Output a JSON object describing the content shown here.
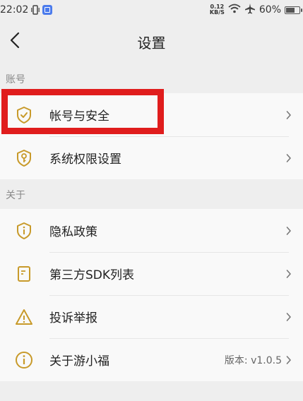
{
  "status_bar": {
    "time": "22:02",
    "net_speed_value": "0.12",
    "net_speed_unit": "KB/S",
    "battery": "60%"
  },
  "header": {
    "title": "设置"
  },
  "sections": [
    {
      "label": "账号",
      "items": [
        {
          "label": "帐号与安全",
          "icon": "shield-check-icon"
        },
        {
          "label": "系统权限设置",
          "icon": "key-icon"
        }
      ]
    },
    {
      "label": "关于",
      "items": [
        {
          "label": "隐私政策",
          "icon": "info-shield-icon"
        },
        {
          "label": "第三方SDK列表",
          "icon": "document-icon"
        },
        {
          "label": "投诉举报",
          "icon": "warning-icon"
        },
        {
          "label": "关于游小福",
          "icon": "info-circle-icon",
          "value": "版本: v1.0.5"
        }
      ]
    }
  ],
  "colors": {
    "icon_gold": "#c89a2a",
    "highlight_red": "#e01d1d",
    "background": "#eeeeee",
    "card": "#f9f9f9"
  }
}
